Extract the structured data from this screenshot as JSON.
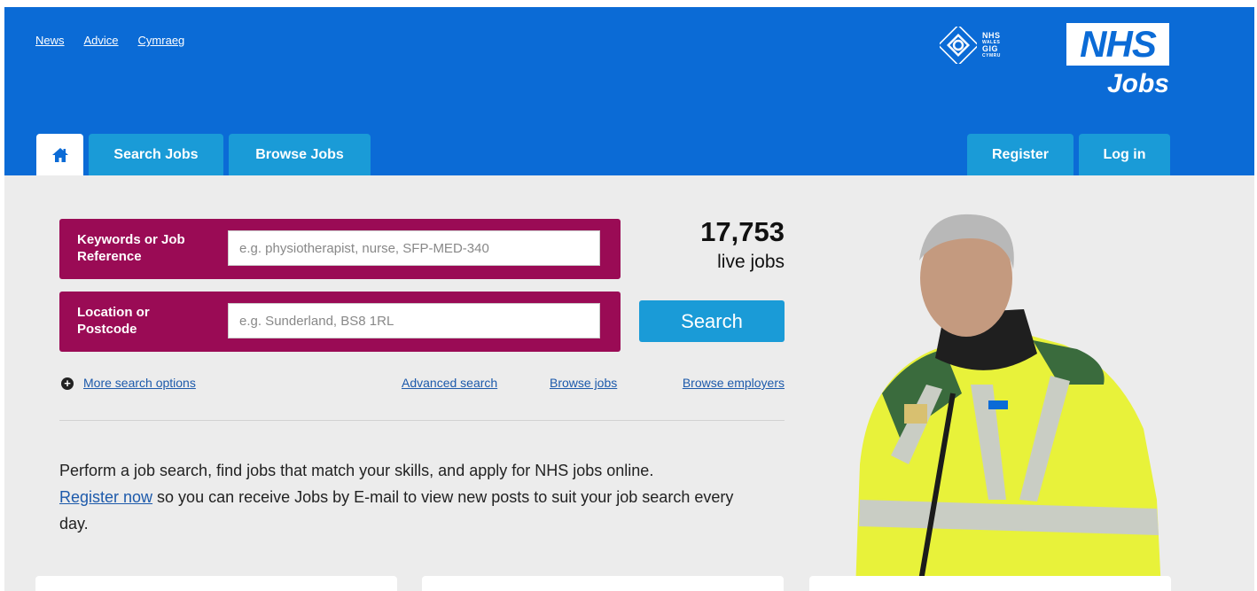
{
  "header": {
    "top_links": [
      "News",
      "Advice",
      "Cymraeg"
    ],
    "nhs_wales_lines": [
      "NHS",
      "WALES",
      "GIG",
      "CYMRU"
    ],
    "nhs_logo": "NHS",
    "nhs_jobs": "Jobs",
    "tabs_left": {
      "home_icon": "home-icon",
      "search_jobs": "Search Jobs",
      "browse_jobs": "Browse Jobs"
    },
    "tabs_right": {
      "register": "Register",
      "login": "Log in"
    }
  },
  "search": {
    "keywords_label": "Keywords or Job Reference",
    "keywords_placeholder": "e.g. physiotherapist, nurse, SFP-MED-340",
    "location_label": "Location or Postcode",
    "location_placeholder": "e.g. Sunderland, BS8 1RL",
    "button": "Search",
    "live_count": "17,753",
    "live_label": "live jobs"
  },
  "options": {
    "more": "More search options",
    "advanced": "Advanced search",
    "browse": "Browse jobs",
    "employers": "Browse employers"
  },
  "intro": {
    "line1": "Perform a job search, find jobs that match your skills, and apply for NHS jobs online.",
    "register_link": "Register now",
    "line2": " so you can receive Jobs by E-mail to view new posts to suit your job search every day."
  },
  "colors": {
    "header_blue": "#0b6bd6",
    "tab_blue": "#1a9bd7",
    "field_magenta": "#9a0b55",
    "link_blue": "#1d5aab"
  }
}
